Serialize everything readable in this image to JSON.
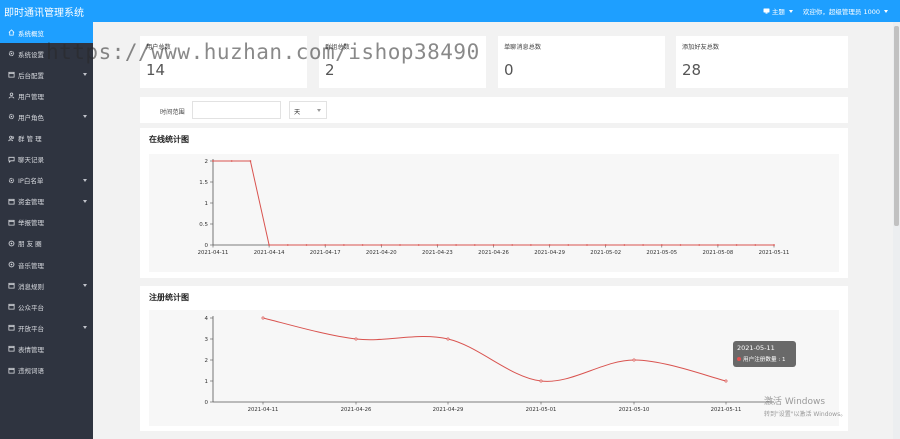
{
  "app": {
    "title": "即时通讯管理系统"
  },
  "topbar": {
    "theme_label": "主题",
    "welcome_text": "欢迎你，超级管理员 1000"
  },
  "sidebar": {
    "items": [
      {
        "label": "系统概览",
        "icon": "home-icon",
        "active": true,
        "expandable": false
      },
      {
        "label": "系统设置",
        "icon": "gear-icon",
        "active": false,
        "expandable": false
      },
      {
        "label": "后台配置",
        "icon": "calendar-icon",
        "active": false,
        "expandable": true
      },
      {
        "label": "用户管理",
        "icon": "user-icon",
        "active": false,
        "expandable": false
      },
      {
        "label": "用户角色",
        "icon": "gear-icon",
        "active": false,
        "expandable": true
      },
      {
        "label": "群 管 理",
        "icon": "users-icon",
        "active": false,
        "expandable": false
      },
      {
        "label": "聊天记录",
        "icon": "message-icon",
        "active": false,
        "expandable": false
      },
      {
        "label": "IP白名单",
        "icon": "gear-icon",
        "active": false,
        "expandable": true
      },
      {
        "label": "资金管理",
        "icon": "calendar-icon",
        "active": false,
        "expandable": true
      },
      {
        "label": "举报管理",
        "icon": "calendar-icon",
        "active": false,
        "expandable": false
      },
      {
        "label": "朋 友 圈",
        "icon": "circle-icon",
        "active": false,
        "expandable": false
      },
      {
        "label": "音乐管理",
        "icon": "circle-icon",
        "active": false,
        "expandable": false
      },
      {
        "label": "消息规则",
        "icon": "calendar-icon",
        "active": false,
        "expandable": true
      },
      {
        "label": "公众平台",
        "icon": "calendar-icon",
        "active": false,
        "expandable": false
      },
      {
        "label": "开放平台",
        "icon": "calendar-icon",
        "active": false,
        "expandable": true
      },
      {
        "label": "表情管理",
        "icon": "calendar-icon",
        "active": false,
        "expandable": false
      },
      {
        "label": "违规词语",
        "icon": "calendar-icon",
        "active": false,
        "expandable": false
      }
    ]
  },
  "stats": [
    {
      "label": "用户总数",
      "value": "14"
    },
    {
      "label": "群组总数",
      "value": "2"
    },
    {
      "label": "单聊消息总数",
      "value": "0"
    },
    {
      "label": "添加好友总数",
      "value": "28"
    }
  ],
  "filter": {
    "range_label": "时间范围",
    "range_value": "",
    "unit_selected": "天"
  },
  "charts": {
    "online": {
      "title": "在线统计图"
    },
    "register": {
      "title": "注册统计图"
    }
  },
  "chart_data": [
    {
      "type": "line",
      "title": "在线统计图",
      "x": [
        "2021-04-11",
        "2021-04-12",
        "2021-04-13",
        "2021-04-14",
        "2021-04-15",
        "2021-04-16",
        "2021-04-17",
        "2021-04-18",
        "2021-04-19",
        "2021-04-20",
        "2021-04-21",
        "2021-04-22",
        "2021-04-23",
        "2021-04-24",
        "2021-04-25",
        "2021-04-26",
        "2021-04-27",
        "2021-04-28",
        "2021-04-29",
        "2021-04-30",
        "2021-05-01",
        "2021-05-02",
        "2021-05-03",
        "2021-05-04",
        "2021-05-05",
        "2021-05-06",
        "2021-05-07",
        "2021-05-08",
        "2021-05-09",
        "2021-05-10",
        "2021-05-11"
      ],
      "x_tick_labels": [
        "2021-04-11",
        "2021-04-14",
        "2021-04-17",
        "2021-04-20",
        "2021-04-23",
        "2021-04-26",
        "2021-04-29",
        "2021-05-02",
        "2021-05-05",
        "2021-05-08",
        "2021-05-11"
      ],
      "series": [
        {
          "values": [
            2,
            2,
            2,
            0,
            0,
            0,
            0,
            0,
            0,
            0,
            0,
            0,
            0,
            0,
            0,
            0,
            0,
            0,
            0,
            0,
            0,
            0,
            0,
            0,
            0,
            0,
            0,
            0,
            0,
            0,
            0
          ],
          "color": "#d9534f"
        }
      ],
      "y_ticks": [
        0,
        0.5,
        1,
        1.5,
        2
      ],
      "ylim": [
        0,
        2
      ],
      "xlabel": "",
      "ylabel": "",
      "grid": false
    },
    {
      "type": "line",
      "title": "注册统计图",
      "x": [
        "2021-04-11",
        "2021-04-26",
        "2021-04-29",
        "2021-05-01",
        "2021-05-10",
        "2021-05-11"
      ],
      "series": [
        {
          "name": "用户注册数量",
          "values": [
            4,
            3,
            3,
            1,
            2,
            1
          ],
          "color": "#d9534f"
        }
      ],
      "y_ticks": [
        0,
        1,
        2,
        3,
        4
      ],
      "ylim": [
        0,
        4
      ],
      "xlabel": "",
      "ylabel": "",
      "grid": false,
      "tooltip": {
        "date": "2021-05-11",
        "label": "用户注册数量 : 1"
      }
    }
  ],
  "watermark": {
    "text": "https://www.huzhan.com/ishop38490"
  },
  "system_overlay": {
    "line1": "激活 Windows",
    "line2": "转到\"设置\"以激活 Windows。"
  },
  "colors": {
    "topbar": "#1e9fff",
    "sidebar": "#2f3440",
    "active_item": "#1e9fff",
    "series": "#d9534f"
  }
}
